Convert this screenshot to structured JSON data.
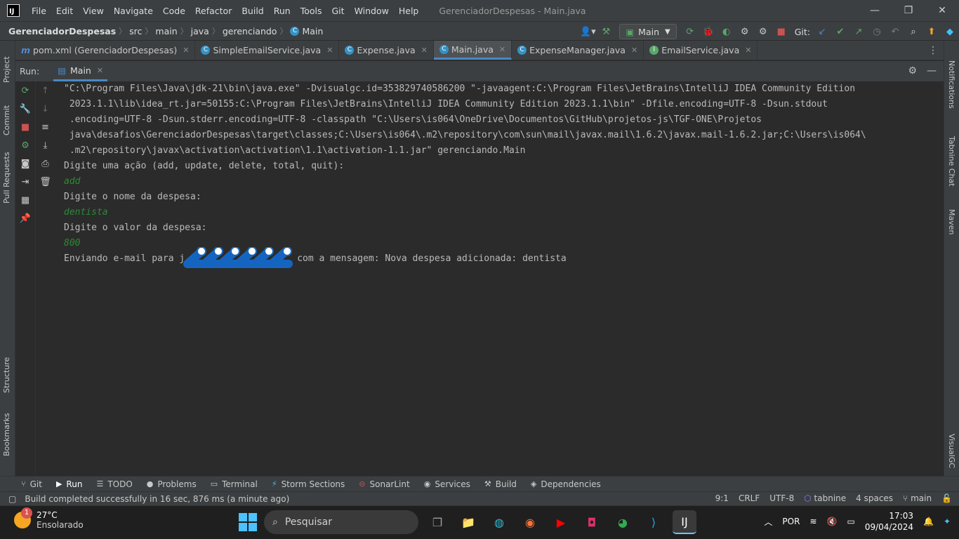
{
  "title_bar": {
    "logo": "IJ",
    "menu": [
      "File",
      "Edit",
      "View",
      "Navigate",
      "Code",
      "Refactor",
      "Build",
      "Run",
      "Tools",
      "Git",
      "Window",
      "Help"
    ],
    "window_title": "GerenciadorDespesas - Main.java",
    "controls": {
      "minimize": "—",
      "restore": "❐",
      "close": "✕"
    }
  },
  "breadcrumb": {
    "project": "GerenciadorDespesas",
    "parts": [
      "src",
      "main",
      "java",
      "gerenciando",
      "Main"
    ]
  },
  "toolbar": {
    "run_config": "Main",
    "git_label": "Git:"
  },
  "tabs": [
    {
      "label": "pom.xml (GerenciadorDespesas)",
      "icon": "maven-icon"
    },
    {
      "label": "SimpleEmailService.java",
      "icon": "class-icon"
    },
    {
      "label": "Expense.java",
      "icon": "class-icon"
    },
    {
      "label": "Main.java",
      "icon": "class-icon",
      "active": true
    },
    {
      "label": "ExpenseManager.java",
      "icon": "class-icon"
    },
    {
      "label": "EmailService.java",
      "icon": "interface-icon"
    }
  ],
  "left_strip": [
    "Project",
    "Commit",
    "Pull Requests",
    "Structure",
    "Bookmarks"
  ],
  "right_strip": [
    "Notifications",
    "Tabnine Chat",
    "Maven",
    "VisualGC"
  ],
  "run_panel": {
    "label": "Run:",
    "tab": "Main"
  },
  "console": {
    "command_lines": [
      "\"C:\\Program Files\\Java\\jdk-21\\bin\\java.exe\" -Dvisualgc.id=353829740586200 \"-javaagent:C:\\Program Files\\JetBrains\\IntelliJ IDEA Community Edition",
      " 2023.1.1\\lib\\idea_rt.jar=50155:C:\\Program Files\\JetBrains\\IntelliJ IDEA Community Edition 2023.1.1\\bin\" -Dfile.encoding=UTF-8 -Dsun.stdout",
      " .encoding=UTF-8 -Dsun.stderr.encoding=UTF-8 -classpath \"C:\\Users\\is064\\OneDrive\\Documentos\\GitHub\\projetos-js\\TGF-ONE\\Projetos",
      " java\\desafios\\GerenciadorDespesas\\target\\classes;C:\\Users\\is064\\.m2\\repository\\com\\sun\\mail\\javax.mail\\1.6.2\\javax.mail-1.6.2.jar;C:\\Users\\is064\\",
      " .m2\\repository\\javax\\activation\\activation\\1.1\\activation-1.1.jar\" gerenciando.Main"
    ],
    "prompt_action": "Digite uma ação (add, update, delete, total, quit):",
    "input_action": "add",
    "prompt_name": "Digite o nome da despesa:",
    "input_name": "dentista",
    "prompt_value": "Digite o valor da despesa:",
    "input_value": "800",
    "email_prefix": "Enviando e-mail para j",
    "email_suffix": "com a mensagem: Nova despesa adicionada: dentista"
  },
  "bottom_tabs": [
    "Git",
    "Run",
    "TODO",
    "Problems",
    "Terminal",
    "Storm Sections",
    "SonarLint",
    "Services",
    "Build",
    "Dependencies"
  ],
  "status": {
    "message": "Build completed successfully in 16 sec, 876 ms (a minute ago)",
    "position": "9:1",
    "line_sep": "CRLF",
    "encoding": "UTF-8",
    "plugin": "tabnine",
    "indent": "4 spaces",
    "branch": "main"
  },
  "taskbar": {
    "temperature": "27°C",
    "weather": "Ensolarado",
    "weather_badge": "1",
    "search": "Pesquisar",
    "language": "POR",
    "time": "17:03",
    "date": "09/04/2024"
  }
}
